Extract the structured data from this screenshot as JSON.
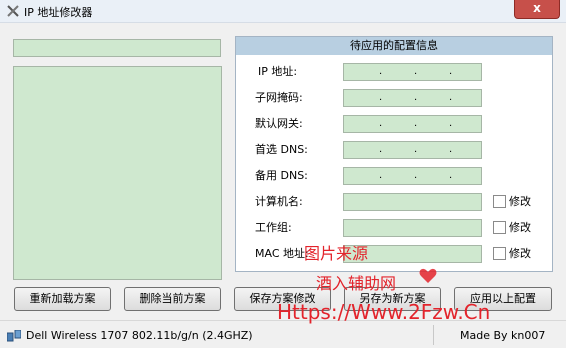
{
  "window": {
    "title": "IP 地址修改器",
    "close_label": "x",
    "brand_color": "#c7504a"
  },
  "config": {
    "header": "待应用的配置信息",
    "labels": {
      "ip": "IP 地址:",
      "mask": "子网掩码:",
      "gateway": "默认网关:",
      "dns1": "首选 DNS:",
      "dns2": "备用 DNS:",
      "computer": "计算机名:",
      "workgroup": "工作组:",
      "mac": "MAC 地址:"
    },
    "ip_sep": ".",
    "modify_label": "修改"
  },
  "buttons": {
    "reload": "重新加载方案",
    "delete": "删除当前方案",
    "save": "保存方案修改",
    "save_as": "另存为新方案",
    "apply": "应用以上配置"
  },
  "status": {
    "adapter": "Dell Wireless 1707 802.11b/g/n (2.4GHZ)",
    "author": "Made By kn007"
  },
  "watermark": {
    "line1": "图片来源",
    "line2": "酒入辅助网",
    "line3": "Https://Www.2Fzw.Cn"
  }
}
